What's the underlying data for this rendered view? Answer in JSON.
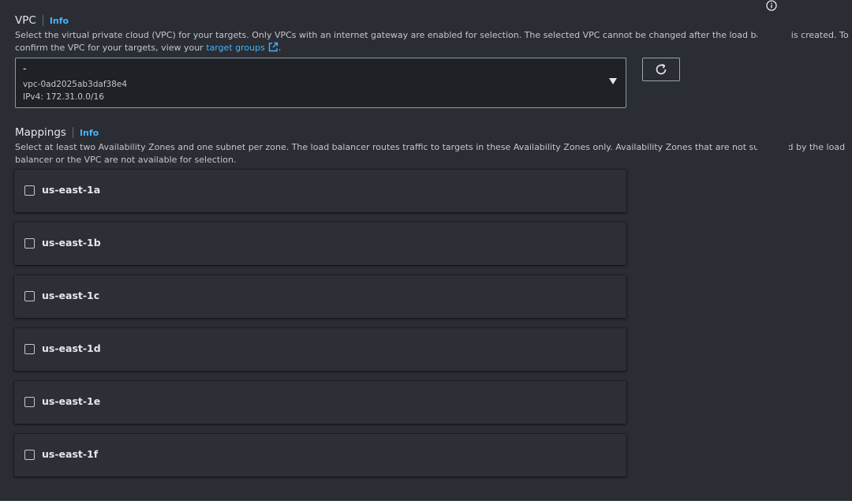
{
  "vpc": {
    "title": "VPC",
    "info": "Info",
    "description_line1": "Select the virtual private cloud (VPC) for your targets. Only VPCs with an internet gateway are enabled for selection. The selected VPC cannot be changed after the load balancer is created. To",
    "description_line2_prefix": "confirm the VPC for your targets, view your",
    "target_groups_link": "target groups",
    "description_line2_suffix": ".",
    "selected": {
      "name": "-",
      "id": "vpc-0ad2025ab3daf38e4",
      "cidr": "IPv4: 172.31.0.0/16"
    }
  },
  "mappings": {
    "title": "Mappings",
    "info": "Info",
    "description_line1": "Select at least two Availability Zones and one subnet per zone. The load balancer routes traffic to targets in these Availability Zones only. Availability Zones that are not supported by the load",
    "description_line2": "balancer or the VPC are not available for selection.",
    "zones": [
      {
        "name": "us-east-1a",
        "checked": false
      },
      {
        "name": "us-east-1b",
        "checked": false
      },
      {
        "name": "us-east-1c",
        "checked": false
      },
      {
        "name": "us-east-1d",
        "checked": false
      },
      {
        "name": "us-east-1e",
        "checked": false
      },
      {
        "name": "us-east-1f",
        "checked": false
      }
    ]
  },
  "icons": {
    "refresh": "refresh-icon",
    "external_link": "external-link-icon",
    "caret": "caret-down-icon",
    "info": "info-circle-icon"
  },
  "colors": {
    "background": "#2a2d33",
    "link": "#42b4ff",
    "panel": "#2c3036",
    "select_bg": "#1e2126"
  }
}
